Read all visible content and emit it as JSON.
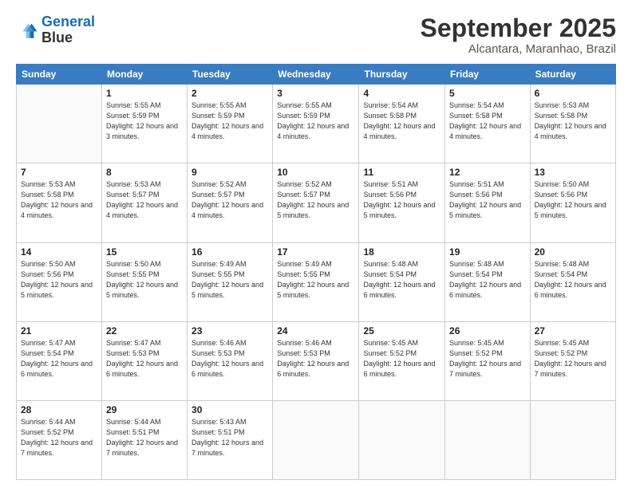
{
  "header": {
    "logo_line1": "General",
    "logo_line2": "Blue",
    "month": "September 2025",
    "location": "Alcantara, Maranhao, Brazil"
  },
  "days_of_week": [
    "Sunday",
    "Monday",
    "Tuesday",
    "Wednesday",
    "Thursday",
    "Friday",
    "Saturday"
  ],
  "weeks": [
    [
      {
        "day": "",
        "info": ""
      },
      {
        "day": "1",
        "info": "Sunrise: 5:55 AM\nSunset: 5:59 PM\nDaylight: 12 hours\nand 3 minutes."
      },
      {
        "day": "2",
        "info": "Sunrise: 5:55 AM\nSunset: 5:59 PM\nDaylight: 12 hours\nand 4 minutes."
      },
      {
        "day": "3",
        "info": "Sunrise: 5:55 AM\nSunset: 5:59 PM\nDaylight: 12 hours\nand 4 minutes."
      },
      {
        "day": "4",
        "info": "Sunrise: 5:54 AM\nSunset: 5:58 PM\nDaylight: 12 hours\nand 4 minutes."
      },
      {
        "day": "5",
        "info": "Sunrise: 5:54 AM\nSunset: 5:58 PM\nDaylight: 12 hours\nand 4 minutes."
      },
      {
        "day": "6",
        "info": "Sunrise: 5:53 AM\nSunset: 5:58 PM\nDaylight: 12 hours\nand 4 minutes."
      }
    ],
    [
      {
        "day": "7",
        "info": "Sunrise: 5:53 AM\nSunset: 5:58 PM\nDaylight: 12 hours\nand 4 minutes."
      },
      {
        "day": "8",
        "info": "Sunrise: 5:53 AM\nSunset: 5:57 PM\nDaylight: 12 hours\nand 4 minutes."
      },
      {
        "day": "9",
        "info": "Sunrise: 5:52 AM\nSunset: 5:57 PM\nDaylight: 12 hours\nand 4 minutes."
      },
      {
        "day": "10",
        "info": "Sunrise: 5:52 AM\nSunset: 5:57 PM\nDaylight: 12 hours\nand 5 minutes."
      },
      {
        "day": "11",
        "info": "Sunrise: 5:51 AM\nSunset: 5:56 PM\nDaylight: 12 hours\nand 5 minutes."
      },
      {
        "day": "12",
        "info": "Sunrise: 5:51 AM\nSunset: 5:56 PM\nDaylight: 12 hours\nand 5 minutes."
      },
      {
        "day": "13",
        "info": "Sunrise: 5:50 AM\nSunset: 5:56 PM\nDaylight: 12 hours\nand 5 minutes."
      }
    ],
    [
      {
        "day": "14",
        "info": "Sunrise: 5:50 AM\nSunset: 5:56 PM\nDaylight: 12 hours\nand 5 minutes."
      },
      {
        "day": "15",
        "info": "Sunrise: 5:50 AM\nSunset: 5:55 PM\nDaylight: 12 hours\nand 5 minutes."
      },
      {
        "day": "16",
        "info": "Sunrise: 5:49 AM\nSunset: 5:55 PM\nDaylight: 12 hours\nand 5 minutes."
      },
      {
        "day": "17",
        "info": "Sunrise: 5:49 AM\nSunset: 5:55 PM\nDaylight: 12 hours\nand 5 minutes."
      },
      {
        "day": "18",
        "info": "Sunrise: 5:48 AM\nSunset: 5:54 PM\nDaylight: 12 hours\nand 6 minutes."
      },
      {
        "day": "19",
        "info": "Sunrise: 5:48 AM\nSunset: 5:54 PM\nDaylight: 12 hours\nand 6 minutes."
      },
      {
        "day": "20",
        "info": "Sunrise: 5:48 AM\nSunset: 5:54 PM\nDaylight: 12 hours\nand 6 minutes."
      }
    ],
    [
      {
        "day": "21",
        "info": "Sunrise: 5:47 AM\nSunset: 5:54 PM\nDaylight: 12 hours\nand 6 minutes."
      },
      {
        "day": "22",
        "info": "Sunrise: 5:47 AM\nSunset: 5:53 PM\nDaylight: 12 hours\nand 6 minutes."
      },
      {
        "day": "23",
        "info": "Sunrise: 5:46 AM\nSunset: 5:53 PM\nDaylight: 12 hours\nand 6 minutes."
      },
      {
        "day": "24",
        "info": "Sunrise: 5:46 AM\nSunset: 5:53 PM\nDaylight: 12 hours\nand 6 minutes."
      },
      {
        "day": "25",
        "info": "Sunrise: 5:45 AM\nSunset: 5:52 PM\nDaylight: 12 hours\nand 6 minutes."
      },
      {
        "day": "26",
        "info": "Sunrise: 5:45 AM\nSunset: 5:52 PM\nDaylight: 12 hours\nand 7 minutes."
      },
      {
        "day": "27",
        "info": "Sunrise: 5:45 AM\nSunset: 5:52 PM\nDaylight: 12 hours\nand 7 minutes."
      }
    ],
    [
      {
        "day": "28",
        "info": "Sunrise: 5:44 AM\nSunset: 5:52 PM\nDaylight: 12 hours\nand 7 minutes."
      },
      {
        "day": "29",
        "info": "Sunrise: 5:44 AM\nSunset: 5:51 PM\nDaylight: 12 hours\nand 7 minutes."
      },
      {
        "day": "30",
        "info": "Sunrise: 5:43 AM\nSunset: 5:51 PM\nDaylight: 12 hours\nand 7 minutes."
      },
      {
        "day": "",
        "info": ""
      },
      {
        "day": "",
        "info": ""
      },
      {
        "day": "",
        "info": ""
      },
      {
        "day": "",
        "info": ""
      }
    ]
  ]
}
